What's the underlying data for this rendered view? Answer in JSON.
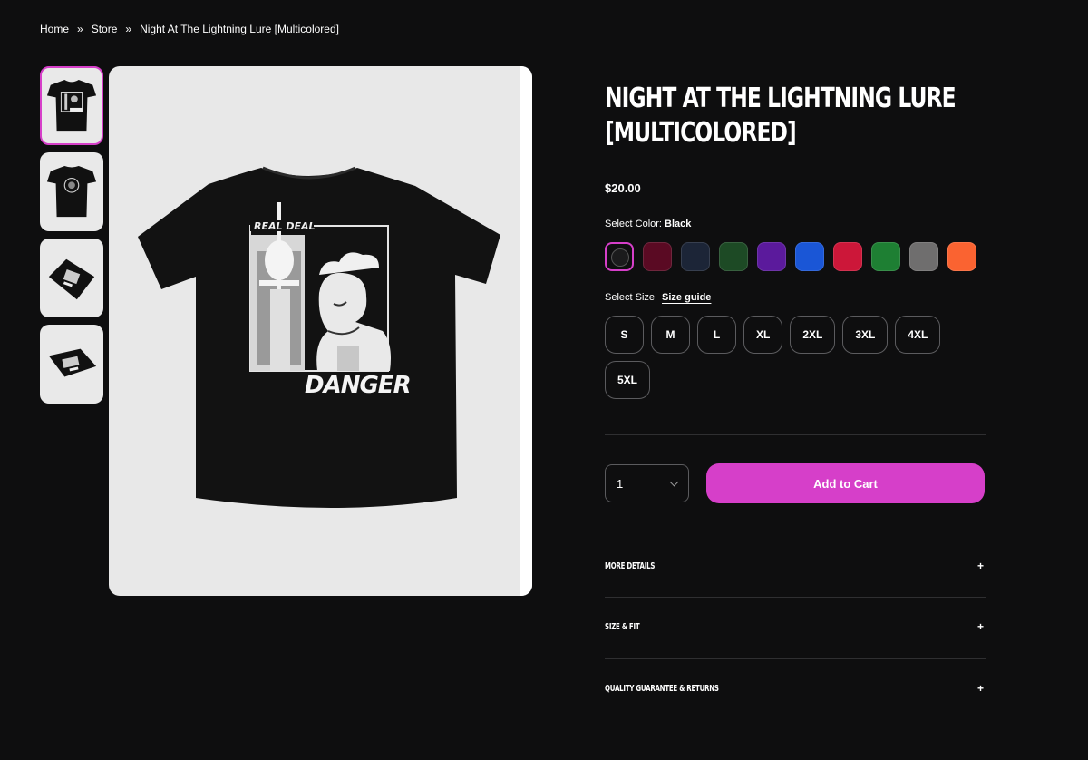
{
  "breadcrumb": {
    "home": "Home",
    "store": "Store",
    "current": "Night At The Lightning Lure [Multicolored]",
    "separator": "»"
  },
  "product": {
    "title": "Night At The Lightning Lure [Multicolored]",
    "price": "$20.00",
    "color_label": "Select Color:",
    "selected_color": "Black",
    "colors": [
      {
        "name": "Black",
        "hex": "#1b1b1c"
      },
      {
        "name": "Maroon",
        "hex": "#5a0a23"
      },
      {
        "name": "Navy",
        "hex": "#1c2537"
      },
      {
        "name": "Forest Green",
        "hex": "#1d4a25"
      },
      {
        "name": "Purple",
        "hex": "#5b1a9c"
      },
      {
        "name": "Royal Blue",
        "hex": "#1a56d6"
      },
      {
        "name": "Red",
        "hex": "#cc1739"
      },
      {
        "name": "Kelly Green",
        "hex": "#1e7f33"
      },
      {
        "name": "Gray",
        "hex": "#6f6e6e"
      },
      {
        "name": "Orange",
        "hex": "#fa6331"
      }
    ],
    "size_label": "Select Size",
    "size_guide": "Size guide",
    "sizes": [
      "S",
      "M",
      "L",
      "XL",
      "2XL",
      "3XL",
      "4XL",
      "5XL"
    ],
    "quantity": "1",
    "add_to_cart": "Add to Cart",
    "accordions": [
      "MORE DETAILS",
      "SIZE & FIT",
      "QUALITY GUARANTEE & RETURNS"
    ],
    "accordion_icon": "+"
  },
  "graphic": {
    "top_text": "REAL DEAL",
    "bottom_text": "DANGER"
  },
  "theme": {
    "accent": "#d63fc9",
    "background": "#0e0e0f"
  }
}
